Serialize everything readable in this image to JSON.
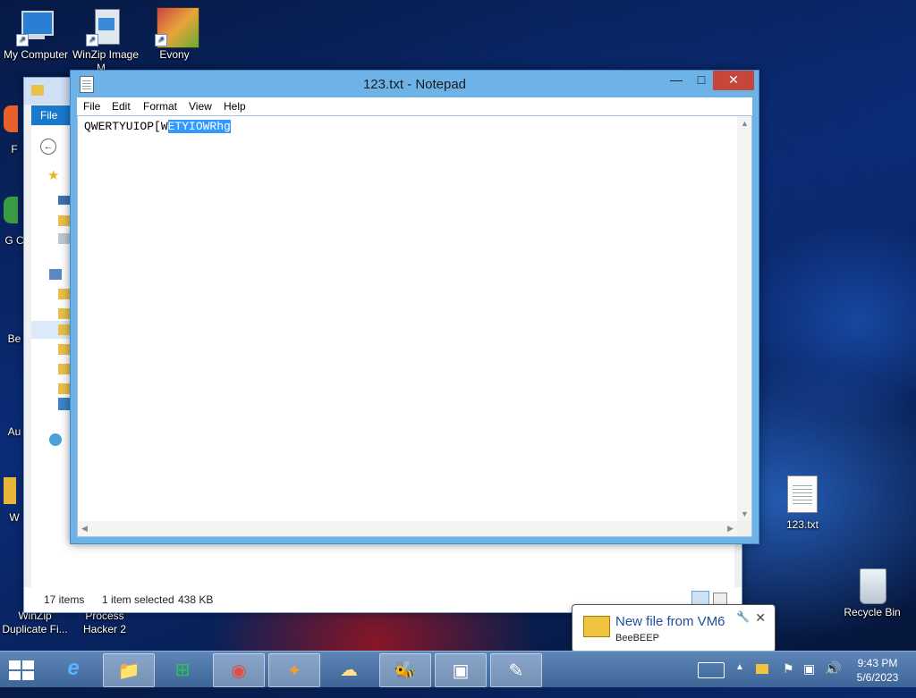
{
  "desktop": {
    "icons_left_top": [
      {
        "label": "My Computer"
      },
      {
        "label": "WinZip Image M..."
      },
      {
        "label": "Evony"
      }
    ],
    "icons_partial_left": [
      {
        "label": "F"
      },
      {
        "label": "G C"
      },
      {
        "label": "Be"
      },
      {
        "label": "Au"
      },
      {
        "label": "W"
      }
    ],
    "icons_bottom_left": [
      {
        "label": "WinZip Duplicate Fi..."
      },
      {
        "label": "Process Hacker 2"
      }
    ],
    "icons_right": [
      {
        "label": "123.txt"
      },
      {
        "label": "Recycle Bin"
      }
    ]
  },
  "explorer": {
    "ribbon_tab": "File",
    "status_items": "17 items",
    "status_selected": "1 item selected",
    "status_size": "438 KB"
  },
  "notepad": {
    "title": "123.txt - Notepad",
    "menu": [
      "File",
      "Edit",
      "Format",
      "View",
      "Help"
    ],
    "text_before_selection": "QWERTYUIOP[W",
    "text_selected": "ETYIOWRhg",
    "controls": {
      "minimize": "—",
      "maximize": "□",
      "close": "✕"
    }
  },
  "notification": {
    "title": "New file from VM6",
    "app": "BeeBEEP",
    "close": "✕",
    "settings_icon": "wrench-icon"
  },
  "taskbar": {
    "items": [
      {
        "icon": "internet-explorer-icon",
        "glyph": "e"
      },
      {
        "icon": "file-explorer-icon",
        "glyph": "📁"
      },
      {
        "icon": "store-icon",
        "glyph": "⊞"
      },
      {
        "icon": "chrome-icon",
        "glyph": "◉"
      },
      {
        "icon": "media-app-icon",
        "glyph": "✦"
      },
      {
        "icon": "network-app-icon",
        "glyph": "☁"
      },
      {
        "icon": "beebeep-icon",
        "glyph": "🐝"
      },
      {
        "icon": "winzip-icon",
        "glyph": "▣"
      },
      {
        "icon": "notepad-icon",
        "glyph": "✎"
      }
    ],
    "clock_time": "9:43 PM",
    "clock_date": "5/6/2023"
  },
  "colors": {
    "notepad_frame": "#6db3e8",
    "selection": "#3399ff",
    "close_button": "#c7463c",
    "taskbar": "#4a72a6"
  }
}
